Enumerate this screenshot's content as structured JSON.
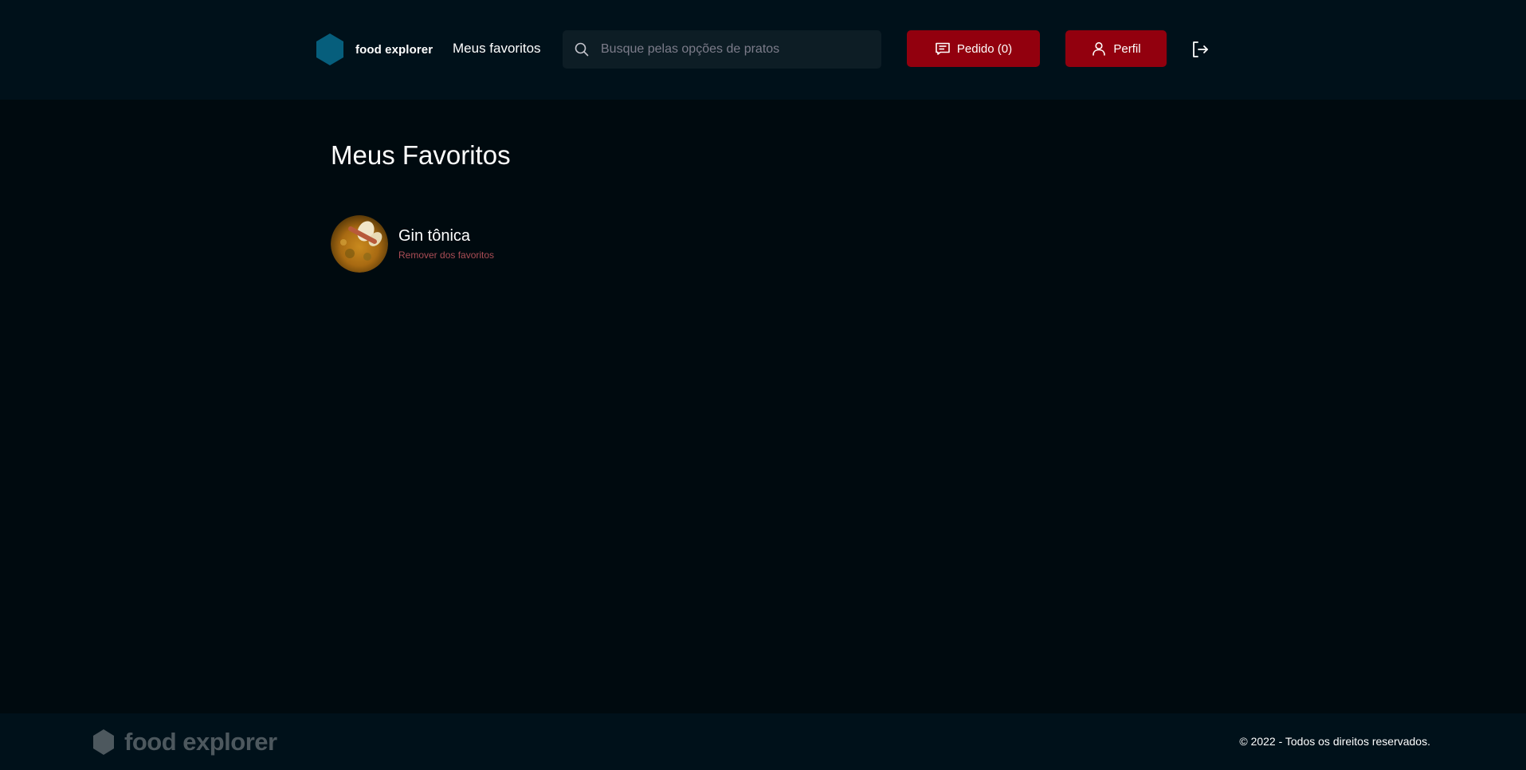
{
  "header": {
    "brand": "food explorer",
    "favorites_link": "Meus favoritos",
    "search": {
      "placeholder": "Busque pelas opções de pratos",
      "value": ""
    },
    "order_button": "Pedido (0)",
    "profile_button": "Perfil"
  },
  "main": {
    "title": "Meus Favoritos",
    "favorites": [
      {
        "name": "Gin tônica",
        "remove_label": "Remover dos favoritos"
      }
    ]
  },
  "footer": {
    "brand": "food explorer",
    "copyright": "© 2022 - Todos os direitos reservados."
  },
  "colors": {
    "background": "#000a0f",
    "header_bg": "#00111a",
    "accent_red": "#92000e",
    "logo_blue": "#065e7c",
    "remove_link": "#ab4d55",
    "footer_logo": "#4d585e"
  }
}
